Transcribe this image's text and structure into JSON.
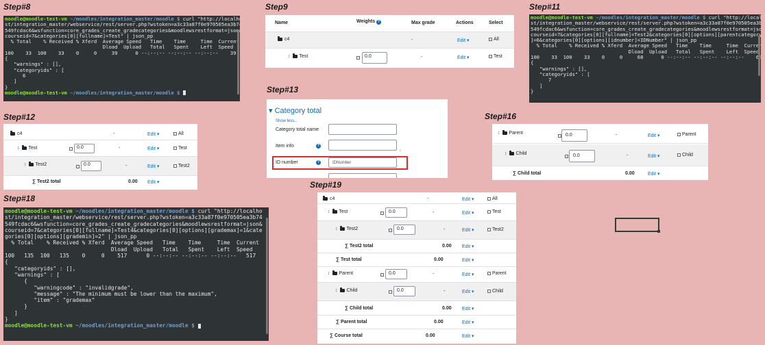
{
  "labels": {
    "s8": "Step#8",
    "s9": "Step9",
    "s11": "Step#11",
    "s12": "Step#12",
    "s13": "Step#13",
    "s16": "Step#16",
    "s18": "Step#18",
    "s19": "Step#19"
  },
  "prompt": {
    "user": "moodle@moodle-test-vm",
    "path": " ~/moodles/integration_master/moodle $ "
  },
  "term8": {
    "cmd": [
      "curl \"http://localho",
      "st/integration_master/webservice/rest/server.php?wstoken=a3c33a87f0e970505ea3b74",
      "549fcdac6&wsfunction=core_grades_create_gradecategories&moodlewsrestformat=json&",
      "courseid=7&categories[0][fullname]=Test\" | json_pp"
    ],
    "out": [
      "  % Total    % Received % Xferd  Average Speed   Time    Time     Time  Current",
      "                                 Dload  Upload   Total   Spent    Left  Speed",
      "100    33  100    33    0     0     39      0 --:--:-- --:--:-- --:--:--    39",
      "{",
      "   \"warnings\" : [],",
      "   \"categoryids\" : [",
      "      6",
      "   ]",
      "}"
    ]
  },
  "term11": {
    "cmd": [
      "curl \"http://localho",
      "st/integration_master/webservice/rest/server.php?wstoken=a3c33a87f0e970505ea3b74",
      "549fcdac6&wsfunction=core_grades_create_gradecategories&moodlewsrestformat=json&",
      "courseid=7&categories[0][fullname]=Test2&categories[0][options][parentcategoryid",
      "]=6&categories[0][options][idnumber]=IDNumber\" | json_pp"
    ],
    "out": [
      "  % Total    % Received % Xferd  Average Speed   Time    Time     Time  Current",
      "                                 Dload  Upload   Total   Spent    Left  Speed",
      "100    33  100    33    0     0     68      0 --:--:-- --:--:-- --:--:--    68",
      "{",
      "   \"warnings\" : [],",
      "   \"categoryids\" : [",
      "      7",
      "   ]",
      "}"
    ]
  },
  "term18": {
    "cmd": [
      "curl \"http://localho",
      "st/integration_master/webservice/rest/server.php?wstoken=a3c33a87f0e970505ea3b74",
      "549fcdac6&wsfunction=core_grades_create_gradecategories&moodlewsrestformat=json&",
      "courseid=7&categories[0][fullname]=Test4&categories[0][options][grademax]=1&cate",
      "gories[0][options][grademin]=2\" | json_pp"
    ],
    "out": [
      "  % Total    % Received % Xferd  Average Speed   Time    Time     Time  Current",
      "                                 Dload  Upload   Total   Spent    Left  Speed",
      "100   135  100   135    0     0    517      0 --:--:-- --:--:-- --:--:--   517",
      "{",
      "   \"categoryids\" : [],",
      "   \"warnings\" : [",
      "      {",
      "         \"warningcode\" : \"invalidgrade\",",
      "         \"message\" : \"The minimum must be lower than the maximum\",",
      "         \"item\" : \"grademax\"",
      "      }",
      "   ]",
      "}"
    ]
  },
  "step9": {
    "headers": {
      "name": "Name",
      "weights": "Weights",
      "maxgrade": "Max grade",
      "actions": "Actions",
      "select": "Select"
    },
    "c4": "c4",
    "test": "Test",
    "dash": "-",
    "weight_value": "0.0",
    "edit": "Edit",
    "all": "All"
  },
  "step12": {
    "c4": "c4",
    "test": "Test",
    "test2": "Test2",
    "test2_total": "Test2 total",
    "dash": "-",
    "weight_value": "0.0",
    "total_value": "0.00",
    "edit": "Edit",
    "all": "All"
  },
  "step13": {
    "heading": "Category total",
    "show_less": "Show less...",
    "field1": "Category total name",
    "field2": "Item info",
    "field3": "ID number",
    "id_value": "IDNumber",
    "help": "?"
  },
  "step16": {
    "parent": "Parent",
    "child": "Child",
    "child_total": "Child total",
    "dash": "-",
    "weight_value": "0.0",
    "total_value": "0.00",
    "edit": "Edit"
  },
  "step19": {
    "c4": "c4",
    "test": "Test",
    "test2": "Test2",
    "test2_total": "Test2 total",
    "test_total": "Test total",
    "parent": "Parent",
    "child": "Child",
    "child_total": "Child total",
    "parent_total": "Parent total",
    "course_total": "Course total",
    "dash": "-",
    "weight_value": "0.0",
    "total_value": "0.00",
    "edit": "Edit",
    "all": "All"
  }
}
